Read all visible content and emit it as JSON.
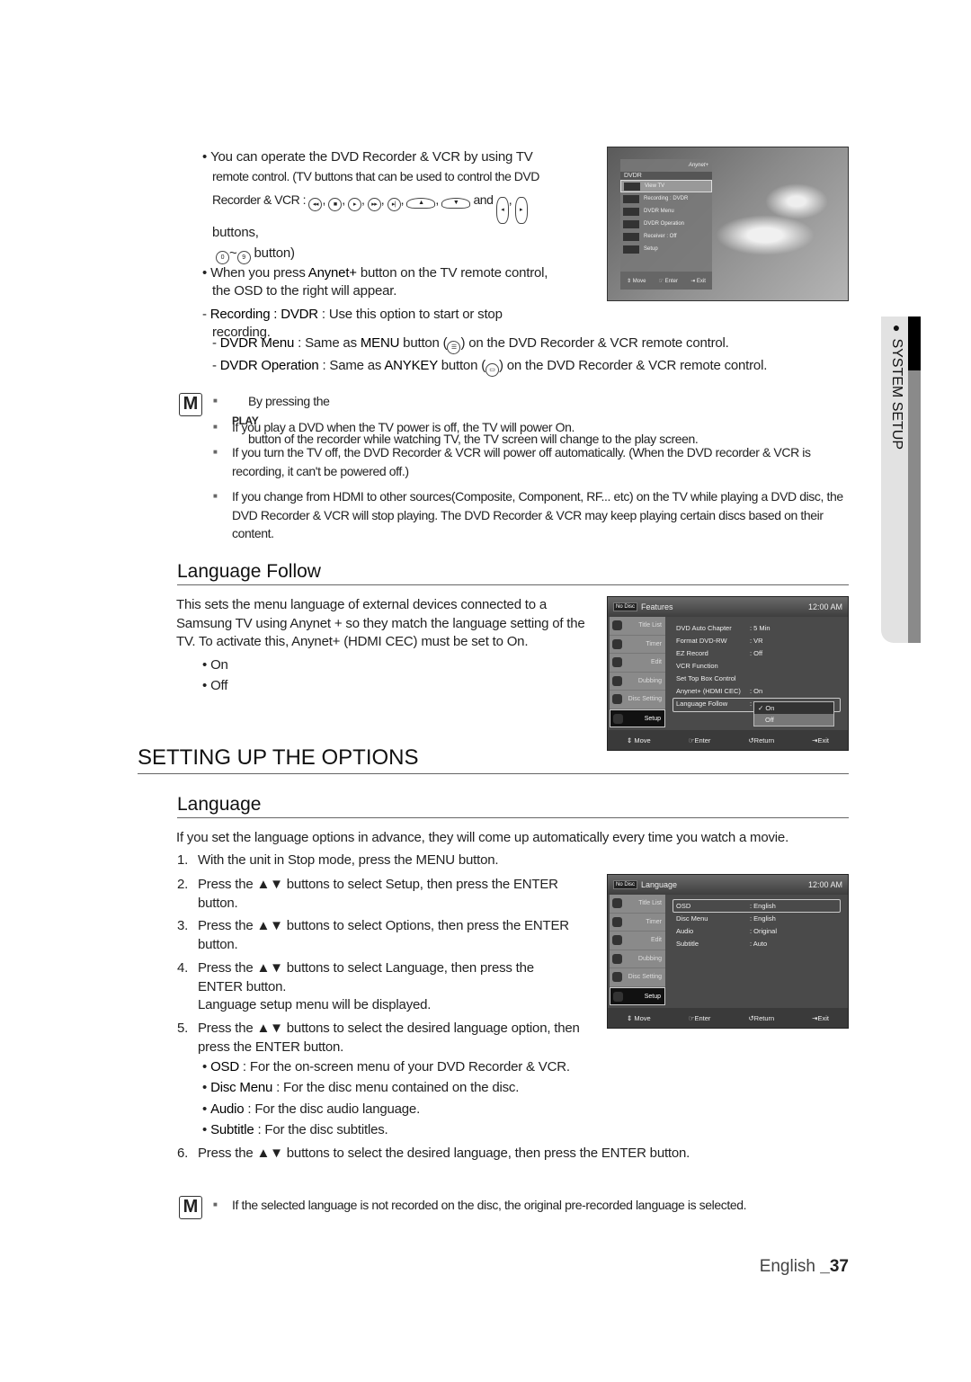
{
  "intro": {
    "bullet1_l1": "You can operate the DVD Recorder & VCR by using TV",
    "bullet1_l2": "remote control. (TV buttons that can be used to control the DVD",
    "bullet1_l3a": "Recorder & VCR :",
    "bullet1_and": "and",
    "bullet1_l4": "buttons,",
    "bullet1_l5": "button)",
    "btn_0": "0",
    "btn_9": "9",
    "tilde": "~",
    "bullet2_a": "When you press ",
    "bullet2_key": "Anynet+",
    "bullet2_b": " button on the TV remote control,",
    "bullet2_l2": "the OSD to the right will appear.",
    "rec_key": "Recording : DVDR",
    "rec_text": " : Use this option to start or stop",
    "rec_l2": "recording.",
    "menu_key": "DVDR Menu",
    "menu_a": " : Same as ",
    "menu_btn": "MENU",
    "menu_b": " button (",
    "menu_c": ") on the DVD Recorder & VCR remote control.",
    "op_key": "DVDR Operation",
    "op_a": " : Same as ",
    "op_btn": "ANYKEY",
    "op_b": " button (",
    "op_c": ") on the DVD Recorder & VCR remote control."
  },
  "notes1": [
    {
      "a": "By pressing the ",
      "k": "PLAY",
      "b": " button of the recorder while watching TV, the TV screen will change to the play screen."
    },
    {
      "a": "If you play a DVD when the TV power is off, the TV will power On."
    },
    {
      "a": "If you turn the TV off, the DVD Recorder & VCR will power off automatically. (When the DVD recorder & VCR is recording, it can't be powered off.)"
    },
    {
      "a": "If you change from HDMI to other sources(Composite, Component, RF... etc) on the TV while playing a DVD disc, the DVD Recorder & VCR will stop playing. The DVD Recorder & VCR may keep playing certain discs based on their content."
    }
  ],
  "osd1": {
    "logo": "Anynet+",
    "title": "DVDR",
    "items": [
      "View TV",
      "Recording : DVDR",
      "DVDR Menu",
      "DVDR Operation",
      "Receiver : Off",
      "Setup"
    ],
    "foot": [
      "⇕ Move",
      "☞ Enter",
      "⇥ Exit"
    ]
  },
  "lang_follow": {
    "heading": "Language Follow",
    "para": "This sets the menu language of external devices connected to a Samsung TV using Anynet + so they match the language setting of the TV. To activate this, Anynet+ (HDMI CEC) must be set to On.",
    "options": [
      "On",
      "Off"
    ]
  },
  "osd_side": [
    "Title List",
    "Timer",
    "Edit",
    "Dubbing",
    "Disc Setting",
    "Setup"
  ],
  "osd_foot": [
    "⇕ Move",
    "☞Enter",
    "↺Return",
    "⇥Exit"
  ],
  "osd2": {
    "nodisc": "No Disc",
    "title": "Features",
    "time": "12:00 AM",
    "rows": [
      [
        "DVD Auto Chapter",
        ": 5 Min"
      ],
      [
        "Format DVD-RW",
        ": VR"
      ],
      [
        "EZ Record",
        ": Off"
      ],
      [
        "VCR Function",
        ""
      ],
      [
        "Set Top Box Control",
        ""
      ],
      [
        "Anynet+ (HDMI CEC)",
        ": On"
      ],
      [
        "Language Follow",
        ":"
      ]
    ],
    "popup": [
      "✓ On",
      "Off"
    ]
  },
  "section_title": "SETTING UP THE OPTIONS",
  "language": {
    "heading": "Language",
    "para": "If you set the language options in advance, they will come up automatically every time you watch a movie.",
    "steps": [
      {
        "n": "1.",
        "t": "With the unit in Stop mode, press the MENU button."
      },
      {
        "n": "2.",
        "t": "Press the ▲▼ buttons to select Setup, then press the ENTER button."
      },
      {
        "n": "3.",
        "t": "Press the ▲▼ buttons to select Options, then press the ENTER button."
      },
      {
        "n": "4.",
        "t": "Press the ▲▼ buttons to select Language, then press the ENTER button.",
        "t2": "Language setup menu will be displayed."
      },
      {
        "n": "5.",
        "t": "Press the ▲▼ buttons to select the desired language option, then press the ENTER button."
      },
      {
        "n": "6.",
        "t": "Press the ▲▼ buttons to select the desired language, then press the ENTER button."
      }
    ],
    "options": [
      {
        "k": "OSD",
        "t": " : For the on-screen menu of your DVD Recorder & VCR."
      },
      {
        "k": "Disc Menu",
        "t": " : For the disc menu contained on the disc."
      },
      {
        "k": "Audio",
        "t": " : For the disc audio language."
      },
      {
        "k": "Subtitle",
        "t": " : For the disc subtitles."
      }
    ],
    "note": "If the selected language is not recorded on the disc, the original pre-recorded language is selected."
  },
  "osd3": {
    "nodisc": "No Disc",
    "title": "Language",
    "time": "12:00 AM",
    "rows": [
      [
        "OSD",
        ": English"
      ],
      [
        "Disc Menu",
        ": English"
      ],
      [
        "Audio",
        ": Original"
      ],
      [
        "Subtitle",
        ": Auto"
      ]
    ]
  },
  "side_tab": "SYSTEM SETUP",
  "footer": {
    "lang": "English ",
    "page": "_37"
  }
}
